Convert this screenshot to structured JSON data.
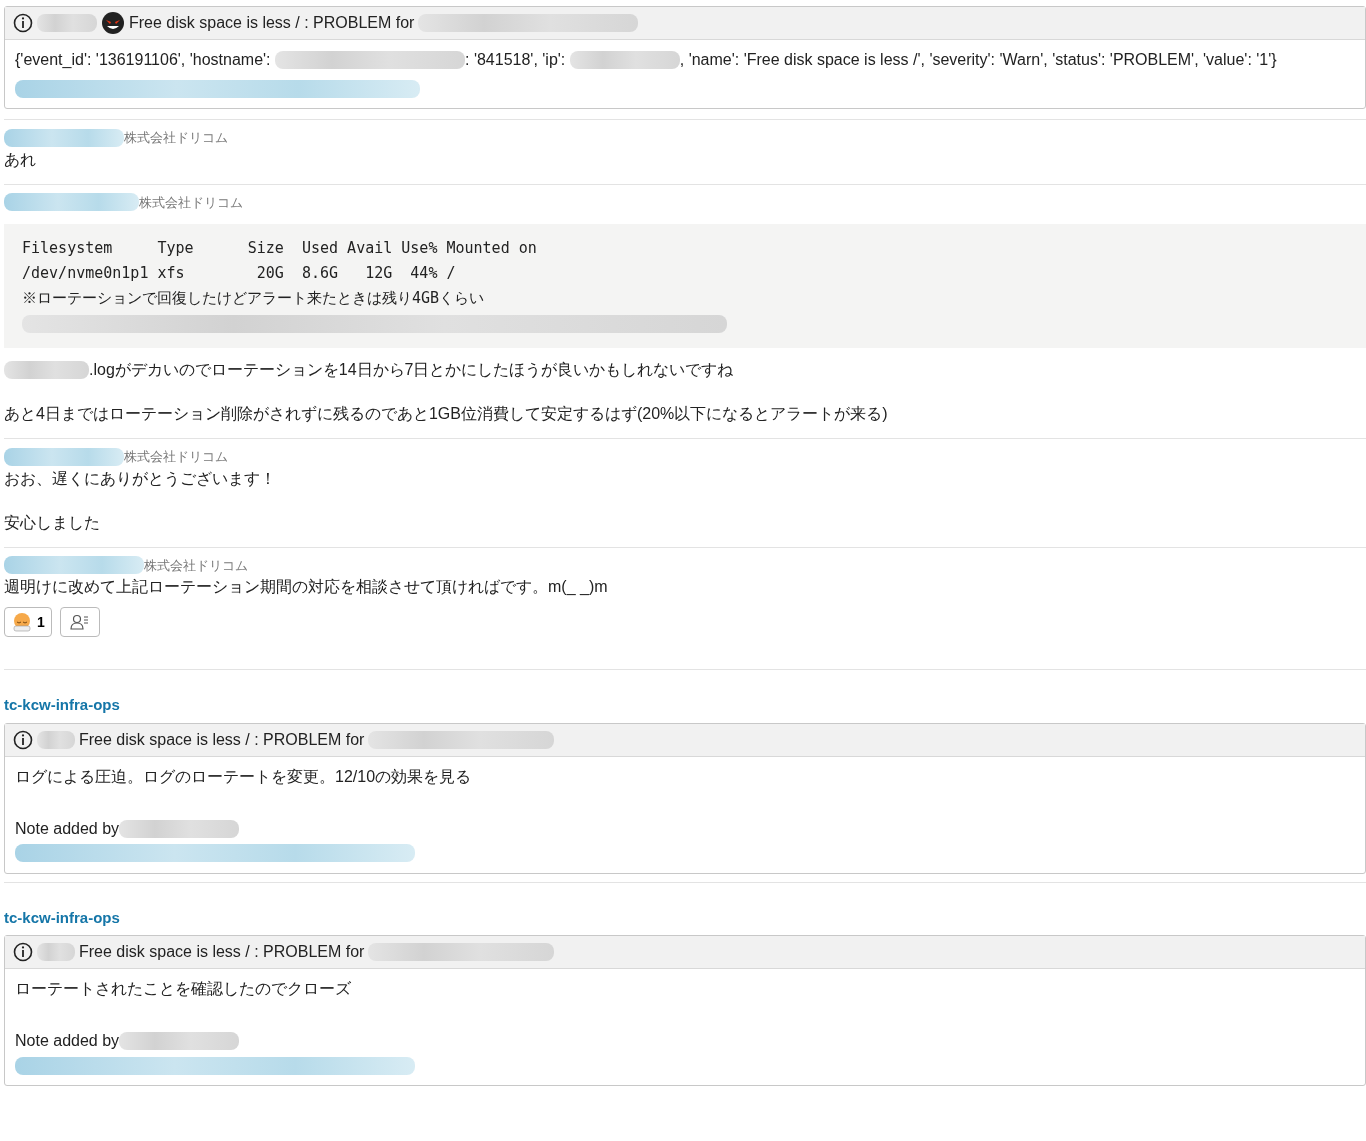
{
  "alert": {
    "title": "Free disk space is less / : PROBLEM for",
    "header_parts": [
      {
        "kind": "redacted"
      },
      {
        "kind": "monster"
      }
    ],
    "header_tail": {
      "kind": "redacted"
    },
    "body": [
      {
        "kind": "text",
        "text": "{'event_id': '136191106', 'hostname': "
      },
      {
        "kind": "redacted"
      },
      {
        "kind": "text",
        "text": ": '841518', 'ip': "
      },
      {
        "kind": "redacted"
      },
      {
        "kind": "text",
        "text": ", 'name': 'Free disk space is less /', 'severity': 'Warn', 'status': 'PROBLEM', 'value': '1'}"
      }
    ],
    "link": {
      "kind": "redacted-link"
    }
  },
  "messages": [
    {
      "author": {
        "kind": "redacted-link"
      },
      "company": "株式会社ドリコム",
      "blocks": [
        {
          "kind": "paragraph",
          "parts": [
            {
              "kind": "text",
              "text": "あれ"
            }
          ]
        }
      ]
    },
    {
      "author": {
        "kind": "redacted-link"
      },
      "company": "株式会社ドリコム",
      "blocks": [
        {
          "kind": "code",
          "lines": [
            {
              "kind": "text",
              "text": "Filesystem     Type      Size  Used Avail Use% Mounted on"
            },
            {
              "kind": "text",
              "text": "/dev/nvme0n1p1 xfs        20G  8.6G   12G  44% /"
            },
            {
              "kind": "text",
              "text": "※ローテーションで回復したけどアラート来たときは残り4GBくらい"
            },
            {
              "kind": "redacted"
            }
          ]
        },
        {
          "kind": "paragraph",
          "parts": [
            {
              "kind": "redacted"
            },
            {
              "kind": "text",
              "text": ".logがデカいのでローテーションを14日から7日とかにしたほうが良いかもしれないですね"
            }
          ]
        },
        {
          "kind": "paragraph",
          "parts": [
            {
              "kind": "text",
              "text": "あと4日まではローテーション削除がされずに残るのであと1GB位消費して安定するはず(20%以下になるとアラートが来る)"
            }
          ]
        }
      ]
    },
    {
      "author": {
        "kind": "redacted-link"
      },
      "company": "株式会社ドリコム",
      "blocks": [
        {
          "kind": "paragraph",
          "parts": [
            {
              "kind": "text",
              "text": "おお、遅くにありがとうございます！"
            }
          ]
        },
        {
          "kind": "paragraph",
          "parts": [
            {
              "kind": "text",
              "text": "安心しました"
            }
          ]
        }
      ]
    },
    {
      "author": {
        "kind": "redacted-link"
      },
      "company": "株式会社ドリコム",
      "blocks": [
        {
          "kind": "paragraph",
          "parts": [
            {
              "kind": "text",
              "text": "週明けに改めて上記ローテーション期間の対応を相談させて頂ければです。m(_ _)m"
            }
          ]
        }
      ],
      "reactions": [
        {
          "count": "1"
        }
      ]
    }
  ],
  "notes": [
    {
      "channel": "tc-kcw-infra-ops",
      "title": "Free disk space is less / : PROBLEM for",
      "text": "ログによる圧迫。ログのローテートを変更。12/10の効果を見る",
      "note_label": "Note added by"
    },
    {
      "channel": "tc-kcw-infra-ops",
      "title": "Free disk space is less / : PROBLEM for",
      "text": "ローテートされたことを確認したのでクローズ",
      "note_label": "Note added by"
    }
  ]
}
